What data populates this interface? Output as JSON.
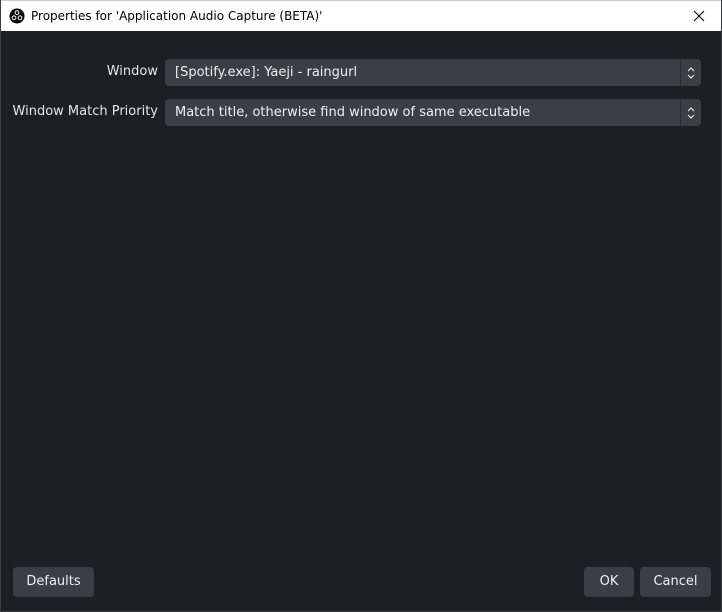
{
  "window": {
    "title": "Properties for 'Application Audio Capture (BETA)'",
    "icon": "obs-logo-icon",
    "close_icon": "close-icon"
  },
  "form": {
    "window_field": {
      "label": "Window",
      "value": "[Spotify.exe]: Yaeji - raingurl"
    },
    "match_priority_field": {
      "label": "Window Match Priority",
      "value": "Match title, otherwise find window of same executable"
    }
  },
  "buttons": {
    "defaults": "Defaults",
    "ok": "OK",
    "cancel": "Cancel"
  },
  "colors": {
    "background": "#1d1f26",
    "control": "#3b3e47",
    "text": "#f0f0f0",
    "titlebar": "#ffffff"
  }
}
